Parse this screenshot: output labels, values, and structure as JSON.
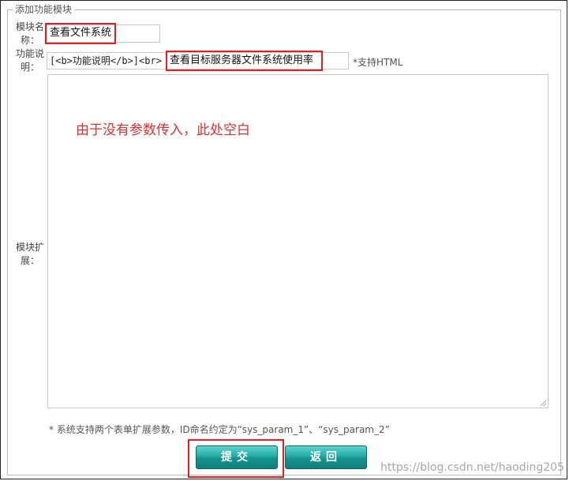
{
  "form": {
    "legend": "添加功能模块",
    "name_label": "模块名称：",
    "name_value": "查看文件系统",
    "desc_label": "功能说明：",
    "desc_prefix": "[<b>功能说明</b>]<br>",
    "desc_value": "查看目标服务器文件系统使用率",
    "desc_hint": "*支持HTML",
    "ext_label": "模块扩展：",
    "ext_annotation": "由于没有参数传入，此处空白",
    "footer_note": "* 系统支持两个表单扩展参数，ID命名约定为“sys_param_1”、“sys_param_2”",
    "submit_label": "提交",
    "back_label": "返回"
  },
  "watermark": "https://blog.csdn.net/haoding205",
  "colors": {
    "highlight": "#e02020",
    "button": "#22aaa3",
    "annotation": "#e03030"
  }
}
